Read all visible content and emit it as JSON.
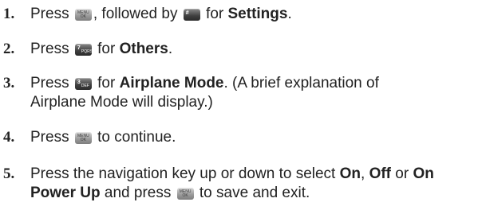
{
  "steps": [
    {
      "n": "1.",
      "a": "Press ",
      "b": ", followed by ",
      "c": " for ",
      "d": "Settings",
      "e": "."
    },
    {
      "n": "2.",
      "a": "Press ",
      "b": " for ",
      "c": "Others",
      "d": "."
    },
    {
      "n": "3.",
      "a": "Press ",
      "b": " for ",
      "c": "Airplane Mode",
      "d": ". (A brief explanation of",
      "e": "Airplane Mode will display.)"
    },
    {
      "n": "4.",
      "a": "Press ",
      "b": " to continue."
    },
    {
      "n": "5.",
      "a": "Press the navigation key up or down to select ",
      "b": "On",
      "c": ", ",
      "d": "Off",
      "e": " or ",
      "f": "On",
      "g": "Power Up",
      "h": " and press ",
      "i": " to save and exit."
    }
  ],
  "keys": {
    "menu_top": "MENU",
    "menu_bottom": "OK",
    "pound_main": "#",
    "seven_main": "7",
    "seven_sub": "PQRS",
    "three_main": "3",
    "three_sub": "DEF"
  }
}
